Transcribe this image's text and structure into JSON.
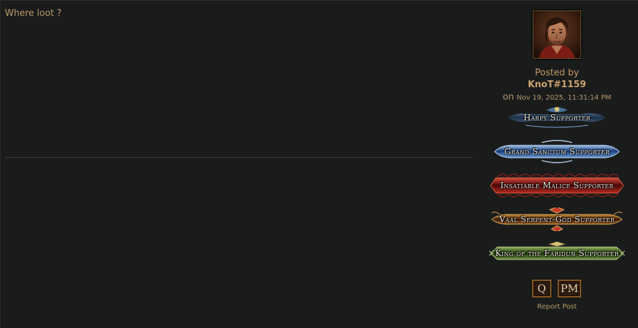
{
  "post": {
    "content": "Where loot ?"
  },
  "author": {
    "posted_by_label": "Posted by",
    "username": "KnoT#1159",
    "on_label": "on",
    "date": "Nov 19, 2025, 11:31:14 PM",
    "avatar_icon": "avatar-portrait-icon"
  },
  "badges": [
    {
      "label": "Harpy Supporter",
      "color": "#3a6ea8"
    },
    {
      "label": "Grand Sanctum Supporter",
      "color": "#2b4f8f"
    },
    {
      "label": "Insatiable Malice Supporter",
      "color": "#8f1a1a"
    },
    {
      "label": "Vaal Serpent-God Supporter",
      "color": "#8a4a16"
    },
    {
      "label": "King of the Faridun Supporter",
      "color": "#3f6b2a"
    }
  ],
  "actions": {
    "quote_label": "Q",
    "pm_label": "PM",
    "report_label": "Report Post"
  }
}
